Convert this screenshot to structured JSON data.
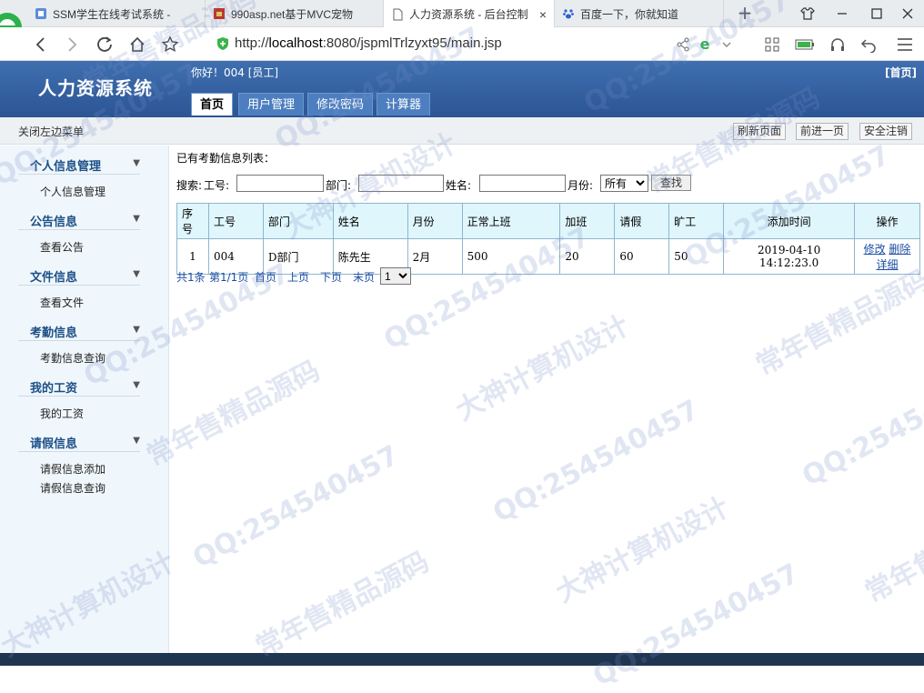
{
  "browser": {
    "tabs": [
      {
        "label": "SSM学生在线考试系统 -",
        "active": false
      },
      {
        "label": "990asp.net基于MVC宠物",
        "active": false
      },
      {
        "label": "人力资源系统 - 后台控制",
        "active": true,
        "close": "×"
      },
      {
        "label": "百度一下，你就知道",
        "active": false
      }
    ],
    "new_tab": "+",
    "url_prefix": "http://",
    "url_host": "localhost",
    "url_rest": ":8080/jspmlTrlzyxt95/main.jsp"
  },
  "header": {
    "title": "人力资源系统",
    "greeting": "你好！004 [员工]",
    "home_link": "[首页]",
    "nav_tabs": [
      "首页",
      "用户管理",
      "修改密码",
      "计算器"
    ]
  },
  "subbar": {
    "toggle": "关闭左边菜单",
    "refresh": "刷新页面",
    "forward": "前进一页",
    "logout": "安全注销"
  },
  "sidebar": {
    "sections": [
      {
        "title": "个人信息管理",
        "items": [
          "个人信息管理"
        ]
      },
      {
        "title": "公告信息",
        "items": [
          "查看公告"
        ]
      },
      {
        "title": "文件信息",
        "items": [
          "查看文件"
        ]
      },
      {
        "title": "考勤信息",
        "items": [
          "考勤信息查询"
        ]
      },
      {
        "title": "我的工资",
        "items": [
          "我的工资"
        ]
      },
      {
        "title": "请假信息",
        "items": [
          "请假信息添加",
          "请假信息查询"
        ]
      }
    ]
  },
  "main": {
    "list_title": "已有考勤信息列表：",
    "search": {
      "label_search": "搜索:",
      "label_id": "工号:",
      "label_dept": "部门:",
      "label_name": "姓名:",
      "label_month": "月份:",
      "id_value": "",
      "dept_value": "",
      "name_value": "",
      "month_selected": "所有",
      "button": "查找"
    },
    "table": {
      "headers": [
        "序号",
        "工号",
        "部门",
        "姓名",
        "月份",
        "正常上班",
        "加班",
        "请假",
        "旷工",
        "添加时间",
        "操作"
      ],
      "rows": [
        {
          "seq": "1",
          "id": "004",
          "dept": "D部门",
          "name": "陈先生",
          "month": "2月",
          "normal": "500",
          "overtime": "20",
          "leave": "60",
          "absent": "50",
          "added": "2019-04-10 14:12:23.0",
          "op_edit": "修改",
          "op_delete": "删除",
          "op_detail": "详细"
        }
      ]
    },
    "pager": {
      "total": "共1条",
      "page": "第1/1页",
      "first": "首页",
      "prev": "上页",
      "next": "下页",
      "last": "末页",
      "page_select": "1"
    }
  },
  "watermarks": [
    "QQ:254540457",
    "常年售精品源码",
    "大神计算机设计"
  ],
  "colors": {
    "header_bg": "#3a68a8",
    "table_header_bg": "#dff6fc",
    "sidebar_bg": "#f0f7fc",
    "link": "#1b4ea2"
  }
}
